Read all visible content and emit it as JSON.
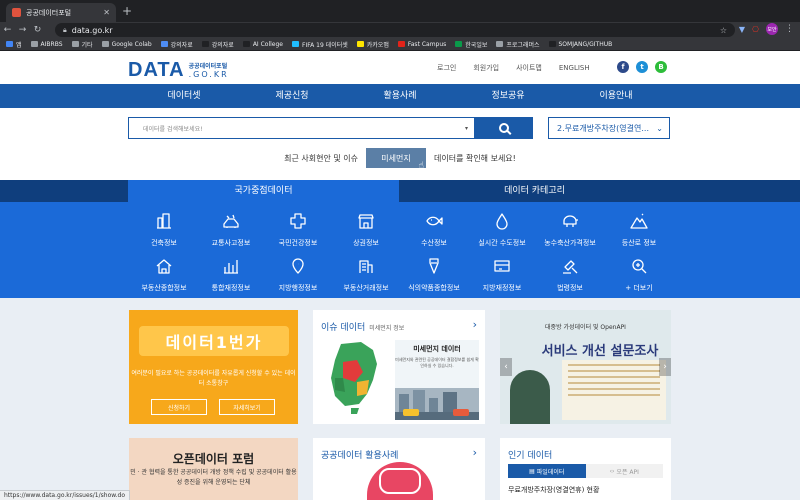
{
  "browser": {
    "tab_title": "공공데이터포털",
    "tab_close": "✕",
    "new_tab": "+",
    "url": "data.go.kr",
    "profile": "보안",
    "status_url": "https://www.data.go.kr/issues/1/show.do"
  },
  "bookmarks": [
    {
      "label": "앱",
      "color": "#4285f4"
    },
    {
      "label": "AIBRBS",
      "color": "#9aa0a6"
    },
    {
      "label": "기타",
      "color": "#9aa0a6"
    },
    {
      "label": "Google Colab",
      "color": "#9aa0a6"
    },
    {
      "label": "강의자료",
      "color": "#4e8df5"
    },
    {
      "label": "강의자료",
      "color": "#202124"
    },
    {
      "label": "AI College",
      "color": "#202124"
    },
    {
      "label": "FIFA 19 데이터셋",
      "color": "#20beff"
    },
    {
      "label": "카카오맵",
      "color": "#fee500"
    },
    {
      "label": "Fast Campus",
      "color": "#e2231a"
    },
    {
      "label": "한국일보",
      "color": "#0a9a4a"
    },
    {
      "label": "프로그래머스",
      "color": "#9aa0a6"
    },
    {
      "label": "SOMJANG/GITHUB",
      "color": "#202124"
    }
  ],
  "header": {
    "logo_main": "DATA",
    "logo_sub_top": "공공데이터포털",
    "logo_sub_bottom": ".GO.KR",
    "util_links": [
      "로그인",
      "회원가입",
      "사이트맵",
      "ENGLISH"
    ],
    "social": [
      {
        "label": "f",
        "color": "#2d4a8a"
      },
      {
        "label": "t",
        "color": "#1d8fd6"
      },
      {
        "label": "B",
        "color": "#2dbd3a"
      }
    ]
  },
  "nav": [
    "데이터셋",
    "제공신청",
    "활용사례",
    "정보공유",
    "이용안내"
  ],
  "search": {
    "placeholder": "데이터를 검색해보세요!",
    "dropdown_arrow": "▾",
    "keyword": "2.무료개방주차장(영결연...",
    "keyword_arrow": "⌄",
    "issue_prefix": "최근 사회현안 및 이슈",
    "issue_chip": "미세먼지",
    "issue_suffix": "데이터를 확인해 보세요!"
  },
  "category_tabs": {
    "active": "국가중점데이터",
    "inactive": "데이터 카테고리"
  },
  "categories": [
    "건축정보",
    "교통사고정보",
    "국민건강정보",
    "상권정보",
    "수산정보",
    "실시간 수도정보",
    "농수축산가격정보",
    "등산로 정보",
    "부동산종합정보",
    "통합재정정보",
    "지방행정정보",
    "부동산거래정보",
    "식의약품종합정보",
    "지방재정정보",
    "법령정보",
    "+ 더보기"
  ],
  "cards": {
    "banner": {
      "title": "데이터1번가",
      "desc": "여러분이 필요로 하는 공공데이터를 자유롭게 신청할 수 있는 데이터 소통창구",
      "btn_apply": "신청하기",
      "btn_more": "자세히보기"
    },
    "issue": {
      "title": "이슈 데이터",
      "subtitle": "미세먼지 정보",
      "chevron": "›",
      "box_title": "미세먼지 데이터",
      "box_desc": "미세먼지와 관련된 공공데이터 결합정보를 쉽게 확인하실 수 있습니다."
    },
    "survey": {
      "top": "대중방 가성데이터 및 OpenAPI",
      "title": "서비스 개선 설문조사",
      "prev": "‹",
      "next": "›"
    },
    "forum": {
      "title": "오픈데이터 포럼",
      "desc": "민 · 관 협력을 통한 공공데이터 개방 정책 수립 및 공공데이터 활용성 증진을 위해 운영되는 단체"
    },
    "usecase": {
      "title": "공공데이터 활용사례",
      "chevron": "›"
    },
    "popular": {
      "title": "인기 데이터",
      "tab_file": "파일데이터",
      "tab_api": "오픈 API",
      "item": "무료개방주차장(영결연휴) 현황"
    }
  }
}
